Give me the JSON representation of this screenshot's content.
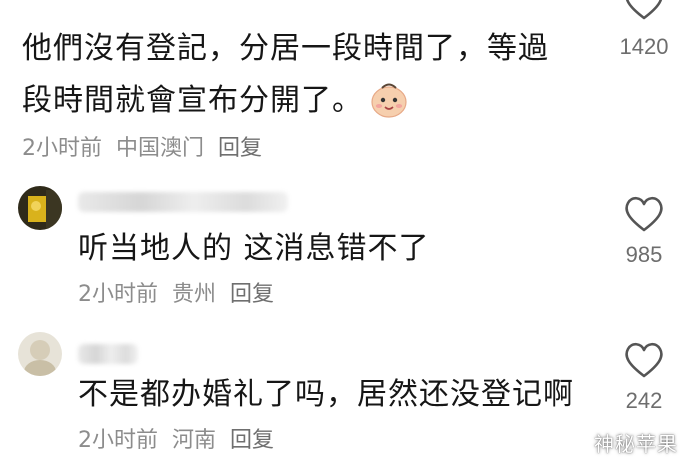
{
  "comments": [
    {
      "lines": [
        "他們沒有登記，分居一段時間了，等過",
        "段時間就會宣布分開了。"
      ],
      "time": "2小时前",
      "location": "中国澳门",
      "reply": "回复",
      "likes": "1420",
      "emoji_icon": "smiling-face-emoji"
    },
    {
      "text": "听当地人的 这消息错不了",
      "time": "2小时前",
      "location": "贵州",
      "reply": "回复",
      "likes": "985"
    },
    {
      "text": "不是都办婚礼了吗，居然还没登记啊",
      "time": "2小时前",
      "location": "河南",
      "reply": "回复",
      "likes": "242"
    }
  ],
  "watermark": "神秘苹果",
  "colors": {
    "meta": "#8c8c8c",
    "text": "#161616",
    "heart": "#555555"
  }
}
